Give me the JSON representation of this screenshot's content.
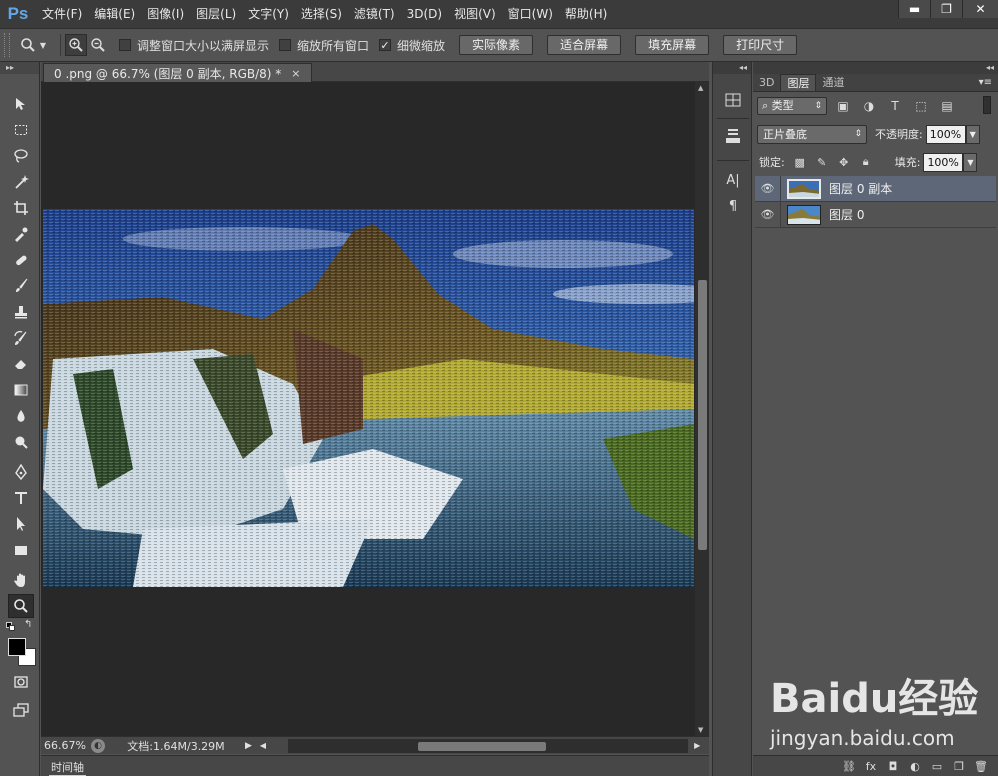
{
  "app": {
    "logo": "Ps",
    "menu": [
      "文件(F)",
      "编辑(E)",
      "图像(I)",
      "图层(L)",
      "文字(Y)",
      "选择(S)",
      "滤镜(T)",
      "3D(D)",
      "视图(V)",
      "窗口(W)",
      "帮助(H)"
    ],
    "window_controls": [
      "▬",
      "❐",
      "✕"
    ]
  },
  "options": {
    "checkbox_resize": "调整窗口大小以满屏显示",
    "checkbox_resize_checked": false,
    "checkbox_zoom_all": "缩放所有窗口",
    "checkbox_zoom_all_checked": false,
    "checkbox_scrubby": "细微缩放",
    "checkbox_scrubby_checked": true,
    "checkmark": "✓",
    "btn_actual": "实际像素",
    "btn_fit": "适合屏幕",
    "btn_fill": "填充屏幕",
    "btn_print": "打印尺寸"
  },
  "document": {
    "tab_title": "0 .png @ 66.7% (图层 0 副本, RGB/8) *",
    "tab_close": "×"
  },
  "status": {
    "zoom": "66.67%",
    "doc_info": "文档:1.64M/3.29M"
  },
  "timeline": {
    "label": "时间轴"
  },
  "panel": {
    "tabs": [
      "3D",
      "图层",
      "通道"
    ],
    "active_tab": 1,
    "filter_type": "类型",
    "blend_mode": "正片叠底",
    "opacity_label": "不透明度:",
    "opacity_value": "100%",
    "lock_label": "锁定:",
    "fill_label": "填充:",
    "fill_value": "100%",
    "layers": [
      {
        "name": "图层 0 副本",
        "selected": true
      },
      {
        "name": "图层 0",
        "selected": false
      }
    ]
  },
  "watermark": {
    "logo": "Bai⁠du经验",
    "url": "jingyan.baidu.com"
  },
  "colors": {
    "foreground": "#000000",
    "background": "#ffffff",
    "selected_layer": "#5d6778",
    "ps_blue": "#62a8e8"
  }
}
